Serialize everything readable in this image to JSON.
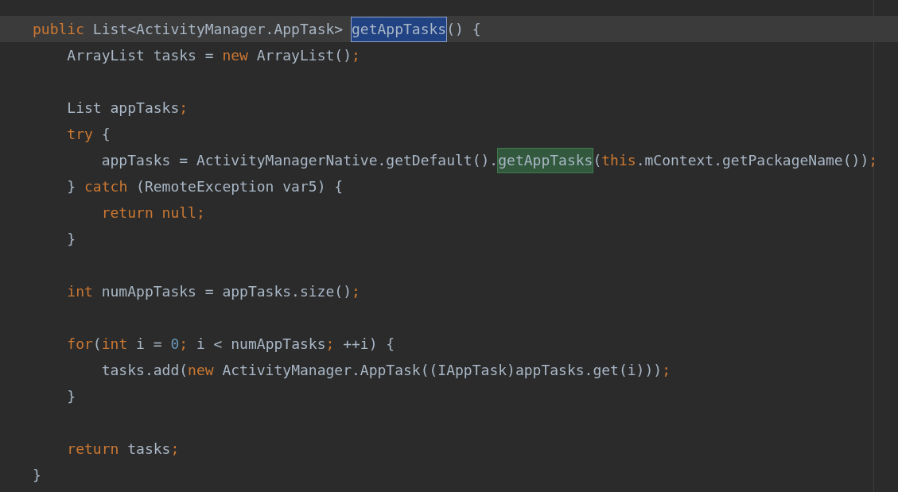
{
  "editor": {
    "lines": [
      {
        "kind": "code",
        "current": true,
        "tokens": [
          {
            "kind": "keyword",
            "text": "public"
          },
          {
            "kind": "plain",
            "text": " List<ActivityManager.AppTask> "
          },
          {
            "kind": "selected",
            "text": "getAppTasks"
          },
          {
            "kind": "plain",
            "text": "() {"
          }
        ]
      },
      {
        "kind": "code",
        "current": false,
        "tokens": [
          {
            "kind": "plain",
            "text": "    ArrayList tasks = "
          },
          {
            "kind": "keyword",
            "text": "new"
          },
          {
            "kind": "plain",
            "text": " ArrayList()"
          },
          {
            "kind": "keyword",
            "text": ";"
          }
        ]
      },
      {
        "kind": "blank",
        "current": false
      },
      {
        "kind": "code",
        "current": false,
        "tokens": [
          {
            "kind": "plain",
            "text": "    List appTasks"
          },
          {
            "kind": "keyword",
            "text": ";"
          }
        ]
      },
      {
        "kind": "code",
        "current": false,
        "tokens": [
          {
            "kind": "keyword",
            "text": "    try"
          },
          {
            "kind": "plain",
            "text": " {"
          }
        ]
      },
      {
        "kind": "code",
        "current": false,
        "tokens": [
          {
            "kind": "plain",
            "text": "        appTasks = ActivityManagerNative.getDefault()."
          },
          {
            "kind": "usage",
            "text": "getAppTasks"
          },
          {
            "kind": "plain",
            "text": "("
          },
          {
            "kind": "keyword",
            "text": "this"
          },
          {
            "kind": "plain",
            "text": ".mContext.getPackageName())"
          },
          {
            "kind": "keyword",
            "text": ";"
          }
        ]
      },
      {
        "kind": "code",
        "current": false,
        "tokens": [
          {
            "kind": "plain",
            "text": "    } "
          },
          {
            "kind": "keyword",
            "text": "catch"
          },
          {
            "kind": "plain",
            "text": " (RemoteException var5) {"
          }
        ]
      },
      {
        "kind": "code",
        "current": false,
        "tokens": [
          {
            "kind": "keyword",
            "text": "        return null;"
          }
        ]
      },
      {
        "kind": "code",
        "current": false,
        "tokens": [
          {
            "kind": "plain",
            "text": "    }"
          }
        ]
      },
      {
        "kind": "blank",
        "current": false
      },
      {
        "kind": "code",
        "current": false,
        "tokens": [
          {
            "kind": "keyword",
            "text": "    int"
          },
          {
            "kind": "plain",
            "text": " numAppTasks = appTasks.size()"
          },
          {
            "kind": "keyword",
            "text": ";"
          }
        ]
      },
      {
        "kind": "blank",
        "current": false
      },
      {
        "kind": "code",
        "current": false,
        "tokens": [
          {
            "kind": "keyword",
            "text": "    for"
          },
          {
            "kind": "plain",
            "text": "("
          },
          {
            "kind": "keyword",
            "text": "int"
          },
          {
            "kind": "plain",
            "text": " i = "
          },
          {
            "kind": "number",
            "text": "0"
          },
          {
            "kind": "keyword",
            "text": ";"
          },
          {
            "kind": "plain",
            "text": " i < numAppTasks"
          },
          {
            "kind": "keyword",
            "text": ";"
          },
          {
            "kind": "plain",
            "text": " ++i) {"
          }
        ]
      },
      {
        "kind": "code",
        "current": false,
        "tokens": [
          {
            "kind": "plain",
            "text": "        tasks.add("
          },
          {
            "kind": "keyword",
            "text": "new"
          },
          {
            "kind": "plain",
            "text": " ActivityManager.AppTask((IAppTask)appTasks.get(i)))"
          },
          {
            "kind": "keyword",
            "text": ";"
          }
        ]
      },
      {
        "kind": "code",
        "current": false,
        "tokens": [
          {
            "kind": "plain",
            "text": "    }"
          }
        ]
      },
      {
        "kind": "blank",
        "current": false
      },
      {
        "kind": "code",
        "current": false,
        "tokens": [
          {
            "kind": "keyword",
            "text": "    return"
          },
          {
            "kind": "plain",
            "text": " tasks"
          },
          {
            "kind": "keyword",
            "text": ";"
          }
        ]
      },
      {
        "kind": "code",
        "current": false,
        "tokens": [
          {
            "kind": "plain",
            "text": "}"
          }
        ]
      }
    ]
  }
}
